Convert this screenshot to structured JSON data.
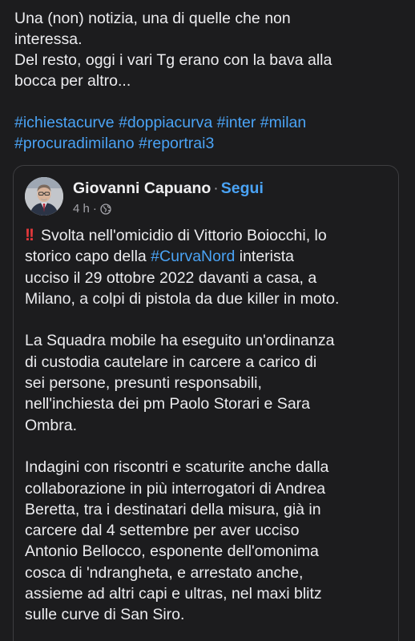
{
  "post": {
    "lines": [
      "Una (non) notizia, una di quelle che non",
      "interessa.",
      "Del resto, oggi i vari Tg erano con la bava alla",
      "bocca per altro..."
    ],
    "hashtags": {
      "line1": [
        "#ichiestacurve",
        "#doppiacurva",
        "#inter",
        "#milan"
      ],
      "line2": [
        "#procuradimilano",
        "#reportrai3"
      ]
    }
  },
  "shared_post": {
    "author": "Giovanni Capuano",
    "separator": "·",
    "follow_label": "Segui",
    "time": "4 h",
    "meta_separator": "·",
    "visibility_icon": "globe-icon",
    "alert_icon": "double-exclamation-icon",
    "alert_glyph": "!!",
    "paragraph1": {
      "line1": "Svolta nell'omicidio di Vittorio Boiocchi, lo",
      "line2_before": "storico capo della ",
      "line2_hashtag": "#CurvaNord",
      "line2_after": " interista",
      "line3": "ucciso il 29 ottobre 2022 davanti a casa, a",
      "line4": "Milano, a colpi di pistola da due killer in moto."
    },
    "paragraph2": [
      "La Squadra mobile ha eseguito un'ordinanza",
      "di custodia cautelare in carcere a carico di",
      "sei persone, presunti responsabili,",
      "nell'inchiesta dei pm Paolo Storari e Sara",
      "Ombra."
    ],
    "paragraph3": [
      "Indagini con riscontri e scaturite anche dalla",
      "collaborazione in più interrogatori di Andrea",
      "Beretta, tra i destinatari della misura, già in",
      "carcere dal 4 settembre per aver ucciso",
      "Antonio Bellocco, esponente dell'omonima",
      "cosca di 'ndrangheta, e arrestato anche,",
      "assieme ad altri capi e ultras, nel maxi blitz",
      "sulle curve di San Siro."
    ]
  },
  "colors": {
    "background": "#1c1c1e",
    "text": "#ececef",
    "link": "#4aa3f5",
    "alert": "#e2383b",
    "border": "#3d3d40"
  }
}
